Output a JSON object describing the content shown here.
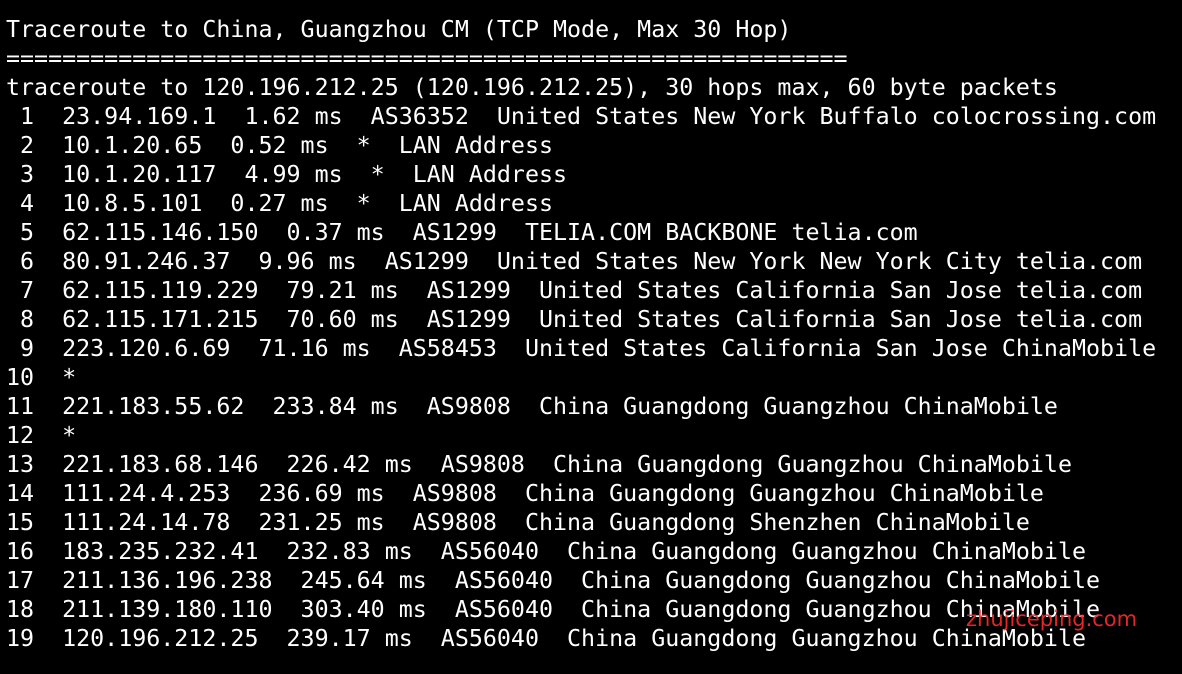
{
  "terminal": {
    "title": "Traceroute to China, Guangzhou CM (TCP Mode, Max 30 Hop)",
    "separator": "============================================================",
    "header": "traceroute to 120.196.212.25 (120.196.212.25), 30 hops max, 60 byte packets",
    "hops": [
      " 1  23.94.169.1  1.62 ms  AS36352  United States New York Buffalo colocrossing.com",
      " 2  10.1.20.65  0.52 ms  *  LAN Address",
      " 3  10.1.20.117  4.99 ms  *  LAN Address",
      " 4  10.8.5.101  0.27 ms  *  LAN Address",
      " 5  62.115.146.150  0.37 ms  AS1299  TELIA.COM BACKBONE telia.com",
      " 6  80.91.246.37  9.96 ms  AS1299  United States New York New York City telia.com",
      " 7  62.115.119.229  79.21 ms  AS1299  United States California San Jose telia.com",
      " 8  62.115.171.215  70.60 ms  AS1299  United States California San Jose telia.com",
      " 9  223.120.6.69  71.16 ms  AS58453  United States California San Jose ChinaMobile",
      "10  *",
      "11  221.183.55.62  233.84 ms  AS9808  China Guangdong Guangzhou ChinaMobile",
      "12  *",
      "13  221.183.68.146  226.42 ms  AS9808  China Guangdong Guangzhou ChinaMobile",
      "14  111.24.4.253  236.69 ms  AS9808  China Guangdong Guangzhou ChinaMobile",
      "15  111.24.14.78  231.25 ms  AS9808  China Guangdong Shenzhen ChinaMobile",
      "16  183.235.232.41  232.83 ms  AS56040  China Guangdong Guangzhou ChinaMobile",
      "17  211.136.196.238  245.64 ms  AS56040  China Guangdong Guangzhou ChinaMobile",
      "18  211.139.180.110  303.40 ms  AS56040  China Guangdong Guangzhou ChinaMobile",
      "19  120.196.212.25  239.17 ms  AS56040  China Guangdong Guangzhou ChinaMobile"
    ]
  },
  "watermark": "zhujiceping.com",
  "colors": {
    "background": "#000000",
    "text": "#ffffff",
    "watermark": "#ff2a2a"
  }
}
